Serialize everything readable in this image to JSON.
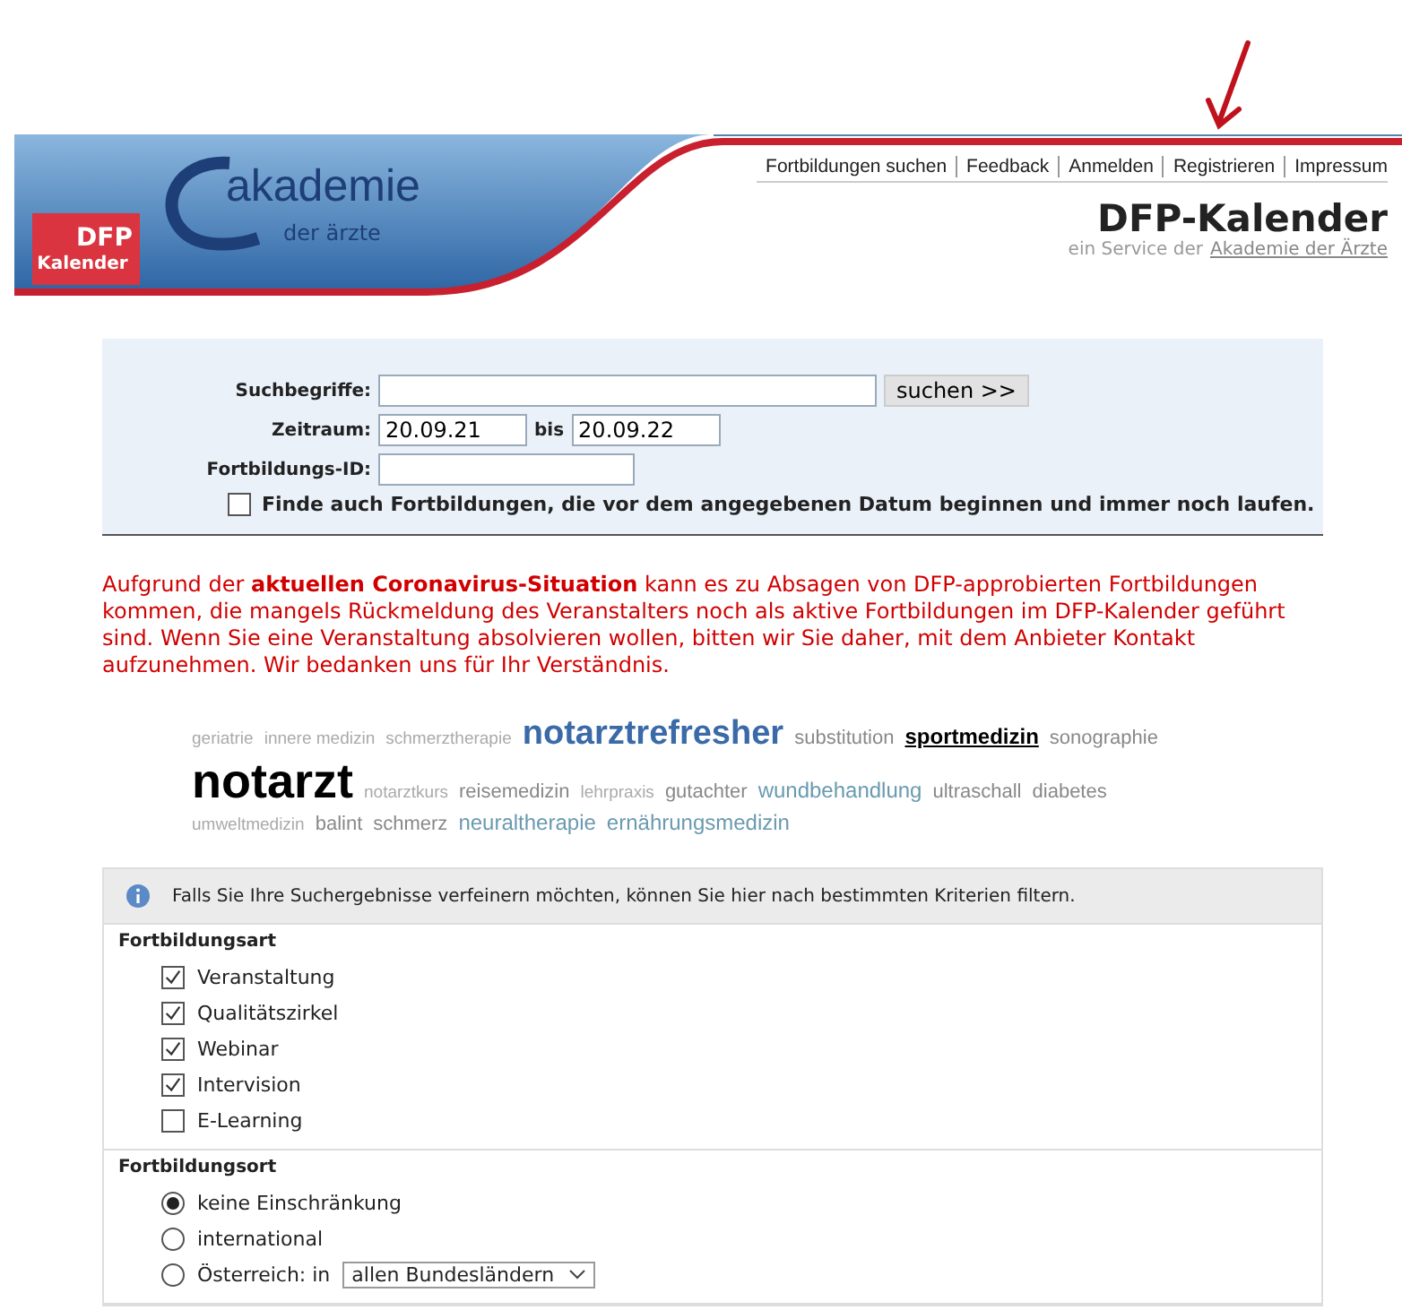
{
  "logo": {
    "main": "akademie",
    "sub": "der ärzte",
    "badge_top": "DFP",
    "badge_bottom": "Kalender"
  },
  "nav": [
    "Fortbildungen suchen",
    "Feedback",
    "Anmelden",
    "Registrieren",
    "Impressum"
  ],
  "page_title": "DFP-Kalender",
  "subtitle": {
    "text": "ein Service der",
    "link": "Akademie der Ärzte"
  },
  "search": {
    "keywords_label": "Suchbegriffe:",
    "submit": "suchen >>",
    "period_label": "Zeitraum:",
    "from": "20.09.21",
    "to_label": "bis",
    "to": "20.09.22",
    "id_label": "Fortbildungs-ID:",
    "running": {
      "label": "Finde auch Fortbildungen, die vor dem angegebenen Datum beginnen und immer noch laufen.",
      "checked": false
    }
  },
  "notice": "Aufgrund der **aktuellen Coronavirus-Situation** kann es zu Absagen von DFP-approbierten Fortbildungen kommen, die mangels Rückmeldung des Veranstalters noch als aktive Fortbildungen im DFP-Kalender geführt sind. Wenn Sie eine Veranstaltung absolvieren wollen, bitten wir Sie daher, mit dem Anbieter Kontakt aufzunehmen. Wir bedanken uns für Ihr Verständnis.",
  "tag_lines": [
    [
      {
        "label": "geriatrie",
        "kind": "faint"
      },
      {
        "label": "innere medizin",
        "kind": "faint"
      },
      {
        "label": "schmerztherapie",
        "kind": "faint"
      },
      {
        "label": "notarztrefresher",
        "kind": "big"
      },
      {
        "label": "substitution",
        "kind": "grey"
      },
      {
        "label": "sportmedizin",
        "kind": "active"
      },
      {
        "label": "sonographie",
        "kind": "grey"
      }
    ],
    [
      {
        "label": "notarzt",
        "kind": "huge"
      },
      {
        "label": "notarztkurs",
        "kind": "faint"
      },
      {
        "label": "reisemedizin",
        "kind": "grey"
      },
      {
        "label": "lehrpraxis",
        "kind": "faint"
      },
      {
        "label": "gutachter",
        "kind": "grey"
      },
      {
        "label": "wundbehandlung",
        "kind": "teal"
      },
      {
        "label": "ultraschall",
        "kind": "grey"
      },
      {
        "label": "diabetes",
        "kind": "grey"
      }
    ],
    [
      {
        "label": "umweltmedizin",
        "kind": "faint"
      },
      {
        "label": "balint",
        "kind": "grey"
      },
      {
        "label": "schmerz",
        "kind": "grey"
      },
      {
        "label": "neuraltherapie",
        "kind": "teal"
      },
      {
        "label": "ernährungsmedizin",
        "kind": "teal"
      }
    ]
  ],
  "filter": {
    "info": "Falls Sie Ihre Suchergebnisse verfeinern möchten, können Sie hier nach bestimmten Kriterien filtern.",
    "sections": [
      {
        "title": "Fortbildungsart",
        "options": [
          {
            "kind": "checkbox",
            "label": "Veranstaltung",
            "checked": true
          },
          {
            "kind": "checkbox",
            "label": "Qualitätszirkel",
            "checked": true
          },
          {
            "kind": "checkbox",
            "label": "Webinar",
            "checked": true
          },
          {
            "kind": "checkbox",
            "label": "Intervision",
            "checked": true
          },
          {
            "kind": "checkbox",
            "label": "E-Learning",
            "checked": false
          }
        ]
      },
      {
        "title": "Fortbildungsort",
        "options": [
          {
            "kind": "radio",
            "label": "keine Einschränkung",
            "selected": true
          },
          {
            "kind": "radio",
            "label": "international",
            "selected": false
          },
          {
            "kind": "radio",
            "label": "Österreich: in",
            "selected": false,
            "dropdown": "allen Bundesländern"
          }
        ]
      }
    ]
  }
}
